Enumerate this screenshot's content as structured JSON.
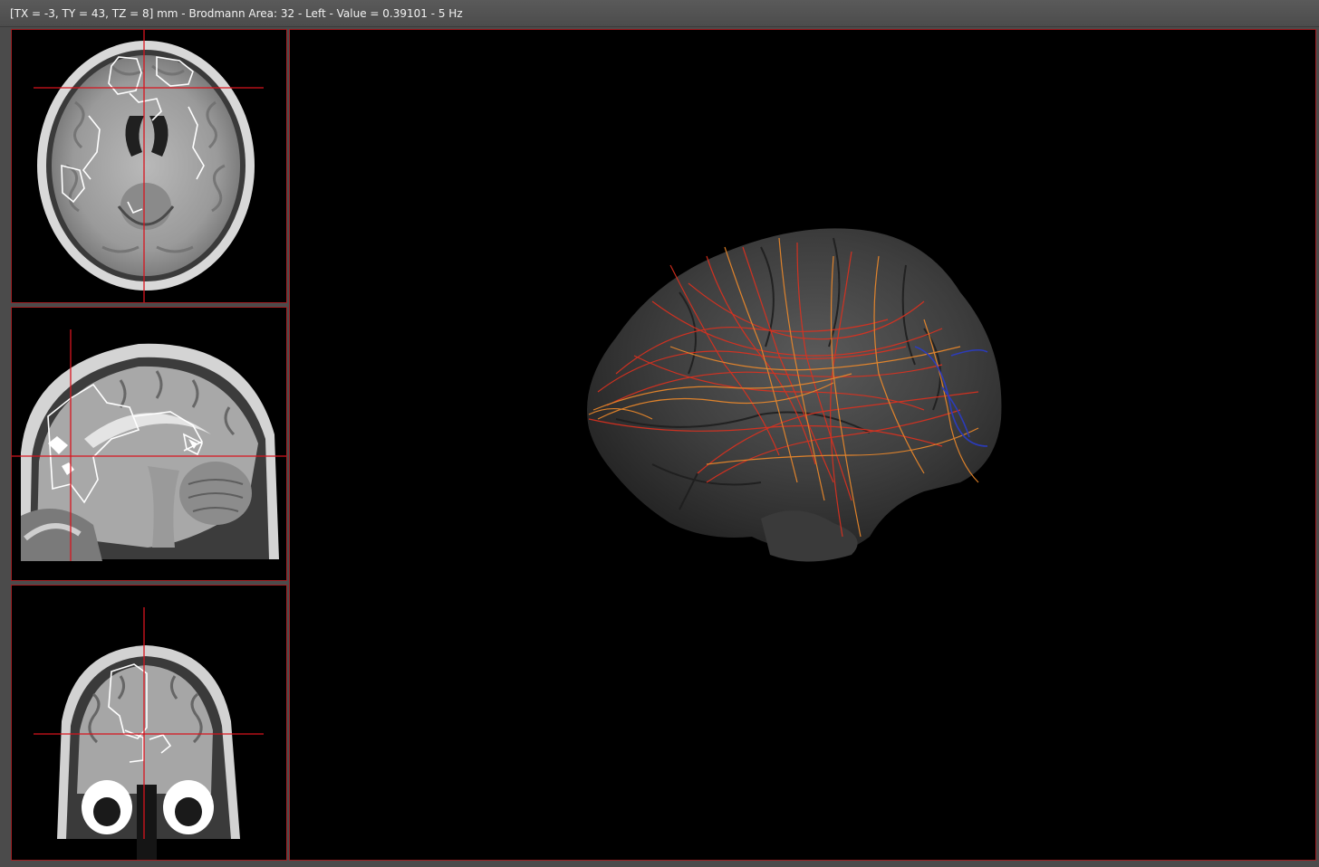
{
  "status": {
    "text": "[TX = -3, TY = 43, TZ = 8] mm - Brodmann Area: 32 - Left - Value = 0.39101 - 5 Hz"
  },
  "views": {
    "axial": "axial-slice",
    "sagittal": "sagittal-slice",
    "coronal": "coronal-slice",
    "render": "3d-tractography"
  },
  "colors": {
    "frame": "#a01e22",
    "crosshair": "#d8141e",
    "background": "#000000",
    "fiber_primary": "#e0301e",
    "fiber_secondary": "#f08a2a",
    "fiber_blue": "#2a3cc8"
  }
}
